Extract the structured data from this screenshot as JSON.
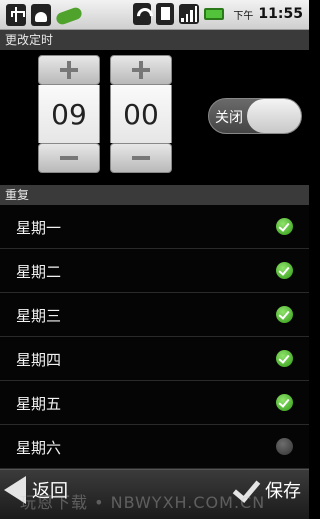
{
  "status_bar": {
    "icons": [
      "usb-icon",
      "android-icon",
      "pea-icon",
      "wifi-icon",
      "sd-card-icon",
      "signal-icon",
      "battery-icon"
    ],
    "ampm": "下午",
    "time": "11:55"
  },
  "section_change_time": "更改定时",
  "picker": {
    "hour": "09",
    "minute": "00"
  },
  "toggle": {
    "label": "关闭"
  },
  "section_repeat": "重复",
  "days": [
    {
      "label": "星期一",
      "checked": true
    },
    {
      "label": "星期二",
      "checked": true
    },
    {
      "label": "星期三",
      "checked": true
    },
    {
      "label": "星期四",
      "checked": true
    },
    {
      "label": "星期五",
      "checked": true
    },
    {
      "label": "星期六",
      "checked": false
    }
  ],
  "bottom_bar": {
    "back_label": "返回",
    "save_label": "保存"
  },
  "watermark": "玩恩下载 • NBWYXH.COM.CN",
  "colors": {
    "check_on": "#3fae1e",
    "check_off": "#4a4a4a",
    "section_header": "#3a3a3a"
  }
}
